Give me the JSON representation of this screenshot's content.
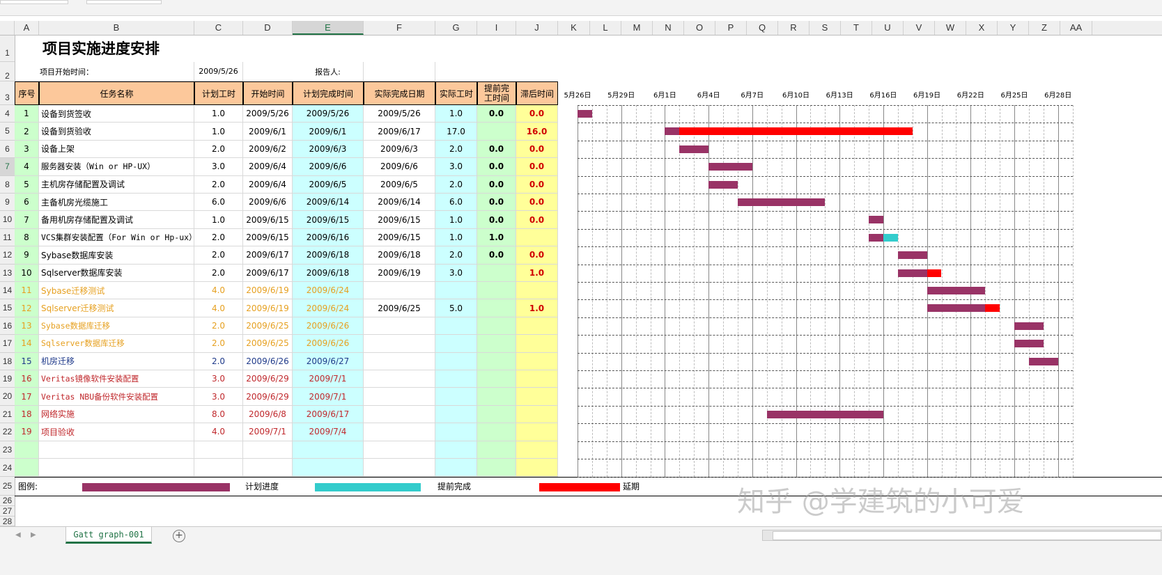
{
  "sheet": {
    "title": "项目实施进度安排",
    "start_label": "项目开始时间：",
    "start_value": "2009/5/26",
    "reporter_label": "报告人:",
    "tab_name": "Gatt graph-001",
    "add_tab": "+",
    "watermark": "知乎 @学建筑的小可爱"
  },
  "columns": [
    "A",
    "B",
    "C",
    "D",
    "E",
    "F",
    "G",
    "I",
    "J",
    "K",
    "L",
    "M",
    "N",
    "O",
    "P",
    "Q",
    "R",
    "S",
    "T",
    "U",
    "V",
    "W",
    "X",
    "Y",
    "Z",
    "AA"
  ],
  "rows": [
    "1",
    "2",
    "3",
    "4",
    "5",
    "6",
    "7",
    "8",
    "9",
    "10",
    "11",
    "12",
    "13",
    "14",
    "15",
    "16",
    "17",
    "18",
    "19",
    "20",
    "21",
    "22",
    "23",
    "24",
    "25",
    "26",
    "27",
    "28"
  ],
  "headers": {
    "seq": "序号",
    "task": "任务名称",
    "plan_hours": "计划工时",
    "start": "开始时间",
    "plan_end": "计划完成时间",
    "actual_end": "实际完成日期",
    "actual_hours": "实际工时",
    "early_1": "提前完",
    "early_2": "工时间",
    "late": "滞后时间"
  },
  "date_headers": [
    "5月26日",
    "5月29日",
    "6月1日",
    "6月4日",
    "6月7日",
    "6月10日",
    "6月13日",
    "6月16日",
    "6月19日",
    "6月22日",
    "6月25日",
    "6月28日"
  ],
  "colors": {
    "header_orange": "#fcc89b",
    "plan_end_blue": "#ccffff",
    "early_green": "#ccffcc",
    "late_yellow": "#ffff99",
    "plan_bar": "#993366",
    "early_bar": "#33cccc",
    "late_bar": "#ff0000"
  },
  "tasks": [
    {
      "no": "1",
      "name": "设备到货签收",
      "plan": "1.0",
      "start": "2009/5/26",
      "end": "2009/5/26",
      "actual": "2009/5/26",
      "ahours": "1.0",
      "early": "0.0",
      "late": "0.0",
      "color": "#000000",
      "mono": false,
      "s": 0,
      "d": 1,
      "e": 0,
      "l": 0
    },
    {
      "no": "2",
      "name": "设备到货验收",
      "plan": "1.0",
      "start": "2009/6/1",
      "end": "2009/6/1",
      "actual": "2009/6/17",
      "ahours": "17.0",
      "early": "",
      "late": "16.0",
      "color": "#000000",
      "mono": false,
      "s": 6,
      "d": 1,
      "e": 0,
      "l": 16
    },
    {
      "no": "3",
      "name": "设备上架",
      "plan": "2.0",
      "start": "2009/6/2",
      "end": "2009/6/3",
      "actual": "2009/6/3",
      "ahours": "2.0",
      "early": "0.0",
      "late": "0.0",
      "color": "#000000",
      "mono": false,
      "s": 7,
      "d": 2,
      "e": 0,
      "l": 0
    },
    {
      "no": "4",
      "name": "服务器安装（Win or HP-UX）",
      "plan": "3.0",
      "start": "2009/6/4",
      "end": "2009/6/6",
      "actual": "2009/6/6",
      "ahours": "3.0",
      "early": "0.0",
      "late": "0.0",
      "color": "#000000",
      "mono": true,
      "s": 9,
      "d": 3,
      "e": 0,
      "l": 0
    },
    {
      "no": "5",
      "name": "主机房存储配置及调试",
      "plan": "2.0",
      "start": "2009/6/4",
      "end": "2009/6/5",
      "actual": "2009/6/5",
      "ahours": "2.0",
      "early": "0.0",
      "late": "0.0",
      "color": "#000000",
      "mono": false,
      "s": 9,
      "d": 2,
      "e": 0,
      "l": 0
    },
    {
      "no": "6",
      "name": "主备机房光缆施工",
      "plan": "6.0",
      "start": "2009/6/6",
      "end": "2009/6/14",
      "actual": "2009/6/14",
      "ahours": "6.0",
      "early": "0.0",
      "late": "0.0",
      "color": "#000000",
      "mono": false,
      "s": 11,
      "d": 6,
      "e": 0,
      "l": 0
    },
    {
      "no": "7",
      "name": "备用机房存储配置及调试",
      "plan": "1.0",
      "start": "2009/6/15",
      "end": "2009/6/15",
      "actual": "2009/6/15",
      "ahours": "1.0",
      "early": "0.0",
      "late": "0.0",
      "color": "#000000",
      "mono": false,
      "s": 20,
      "d": 1,
      "e": 0,
      "l": 0
    },
    {
      "no": "8",
      "name": "VCS集群安装配置（For Win or Hp-ux）",
      "plan": "2.0",
      "start": "2009/6/15",
      "end": "2009/6/16",
      "actual": "2009/6/15",
      "ahours": "1.0",
      "early": "1.0",
      "late": "",
      "color": "#000000",
      "mono": true,
      "s": 20,
      "d": 1,
      "e": 1,
      "l": 0
    },
    {
      "no": "9",
      "name": "Sybase数据库安装",
      "plan": "2.0",
      "start": "2009/6/17",
      "end": "2009/6/18",
      "actual": "2009/6/18",
      "ahours": "2.0",
      "early": "0.0",
      "late": "0.0",
      "color": "#000000",
      "mono": false,
      "s": 22,
      "d": 2,
      "e": 0,
      "l": 0
    },
    {
      "no": "10",
      "name": "Sqlserver数据库安装",
      "plan": "2.0",
      "start": "2009/6/17",
      "end": "2009/6/18",
      "actual": "2009/6/19",
      "ahours": "3.0",
      "early": "",
      "late": "1.0",
      "color": "#000000",
      "mono": false,
      "s": 22,
      "d": 2,
      "e": 0,
      "l": 1
    },
    {
      "no": "11",
      "name": "Sybase迁移测试",
      "plan": "4.0",
      "start": "2009/6/19",
      "end": "2009/6/24",
      "actual": "",
      "ahours": "",
      "early": "",
      "late": "",
      "color": "#e6a020",
      "mono": false,
      "s": 24,
      "d": 4,
      "e": 0,
      "l": 0
    },
    {
      "no": "12",
      "name": "Sqlserver迁移测试",
      "plan": "4.0",
      "start": "2009/6/19",
      "end": "2009/6/24",
      "actual": "2009/6/25",
      "ahours": "5.0",
      "early": "",
      "late": "1.0",
      "color": "#e6a020",
      "mono": false,
      "s": 24,
      "d": 4,
      "e": 0,
      "l": 1
    },
    {
      "no": "13",
      "name": "Sybase数据库迁移",
      "plan": "2.0",
      "start": "2009/6/25",
      "end": "2009/6/26",
      "actual": "",
      "ahours": "",
      "early": "",
      "late": "",
      "color": "#e6a020",
      "mono": true,
      "s": 30,
      "d": 2,
      "e": 0,
      "l": 0
    },
    {
      "no": "14",
      "name": "Sqlserver数据库迁移",
      "plan": "2.0",
      "start": "2009/6/25",
      "end": "2009/6/26",
      "actual": "",
      "ahours": "",
      "early": "",
      "late": "",
      "color": "#e6a020",
      "mono": true,
      "s": 30,
      "d": 2,
      "e": 0,
      "l": 0
    },
    {
      "no": "15",
      "name": "机房迁移",
      "plan": "2.0",
      "start": "2009/6/26",
      "end": "2009/6/27",
      "actual": "",
      "ahours": "",
      "early": "",
      "late": "",
      "color": "#1f3a8a",
      "mono": false,
      "s": 31,
      "d": 2,
      "e": 0,
      "l": 0
    },
    {
      "no": "16",
      "name": "Veritas镜像软件安装配置",
      "plan": "3.0",
      "start": "2009/6/29",
      "end": "2009/7/1",
      "actual": "",
      "ahours": "",
      "early": "",
      "late": "",
      "color": "#c0282c",
      "mono": true,
      "s": 0,
      "d": 0,
      "e": 0,
      "l": 0
    },
    {
      "no": "17",
      "name": "Veritas NBU备份软件安装配置",
      "plan": "3.0",
      "start": "2009/6/29",
      "end": "2009/7/1",
      "actual": "",
      "ahours": "",
      "early": "",
      "late": "",
      "color": "#c0282c",
      "mono": true,
      "s": 0,
      "d": 0,
      "e": 0,
      "l": 0
    },
    {
      "no": "18",
      "name": "网络实施",
      "plan": "8.0",
      "start": "2009/6/8",
      "end": "2009/6/17",
      "actual": "",
      "ahours": "",
      "early": "",
      "late": "",
      "color": "#c0282c",
      "mono": false,
      "s": 13,
      "d": 8,
      "e": 0,
      "l": 0
    },
    {
      "no": "19",
      "name": "项目验收",
      "plan": "4.0",
      "start": "2009/7/1",
      "end": "2009/7/4",
      "actual": "",
      "ahours": "",
      "early": "",
      "late": "",
      "color": "#c0282c",
      "mono": false,
      "s": 0,
      "d": 0,
      "e": 0,
      "l": 0
    }
  ],
  "legend": {
    "label": "图例:",
    "plan": "计划进度",
    "early": "提前完成",
    "late": "延期"
  }
}
